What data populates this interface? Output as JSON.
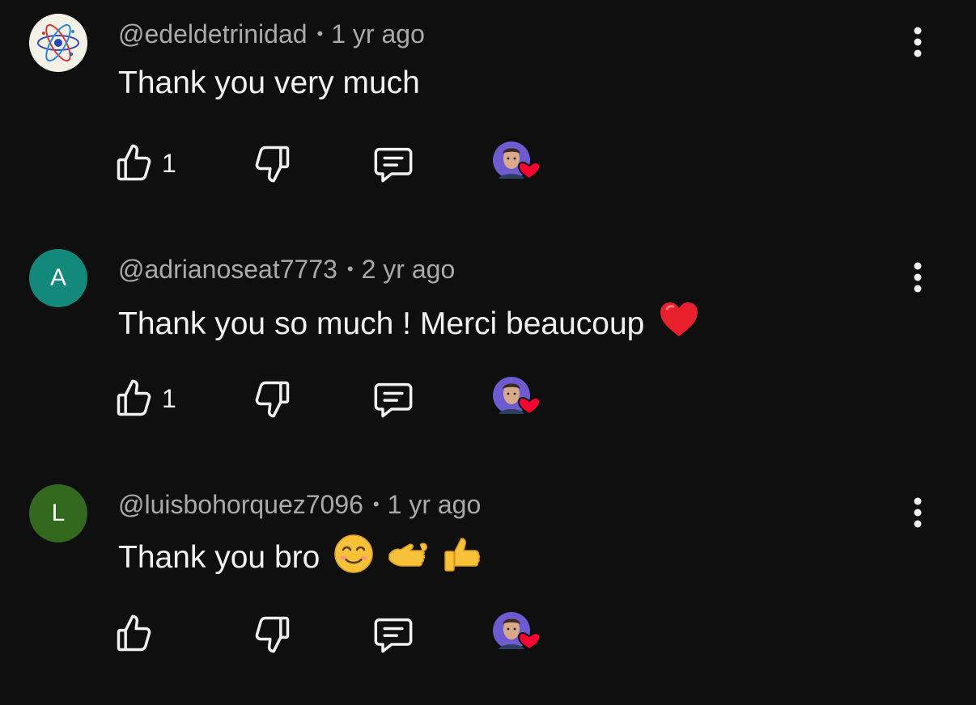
{
  "comments": [
    {
      "author": "@edeldetrinidad",
      "separator": "•",
      "age": "1 yr ago",
      "text": "Thank you very much",
      "emojis": "",
      "avatar_type": "atom-image",
      "avatar_letter": "",
      "avatar_color": "#f3f0e6",
      "like_count": "1",
      "creator_heart": true
    },
    {
      "author": "@adrianoseat7773",
      "separator": "•",
      "age": "2 yr ago",
      "text": "Thank you so much ! Merci beaucoup",
      "emojis": "red-heart",
      "avatar_type": "letter",
      "avatar_letter": "A",
      "avatar_color": "#12897a",
      "like_count": "1",
      "creator_heart": true
    },
    {
      "author": "@luisbohorquez7096",
      "separator": "•",
      "age": "1 yr ago",
      "text": "Thank you bro",
      "emojis": "smiling-face, call-me-hand, thumbs-up",
      "avatar_type": "letter",
      "avatar_letter": "L",
      "avatar_color": "#33691e",
      "like_count": "",
      "creator_heart": true
    }
  ],
  "colors": {
    "background": "#0f0f0f",
    "primary_text": "#f1f1f1",
    "secondary_text": "#aaaaaa",
    "heart": "#ff0033"
  },
  "icons": {
    "like": "thumbs-up-outline-icon",
    "dislike": "thumbs-down-outline-icon",
    "reply": "comment-reply-icon",
    "more": "vertical-ellipsis-icon",
    "creator_heart": "creator-heart-icon"
  }
}
